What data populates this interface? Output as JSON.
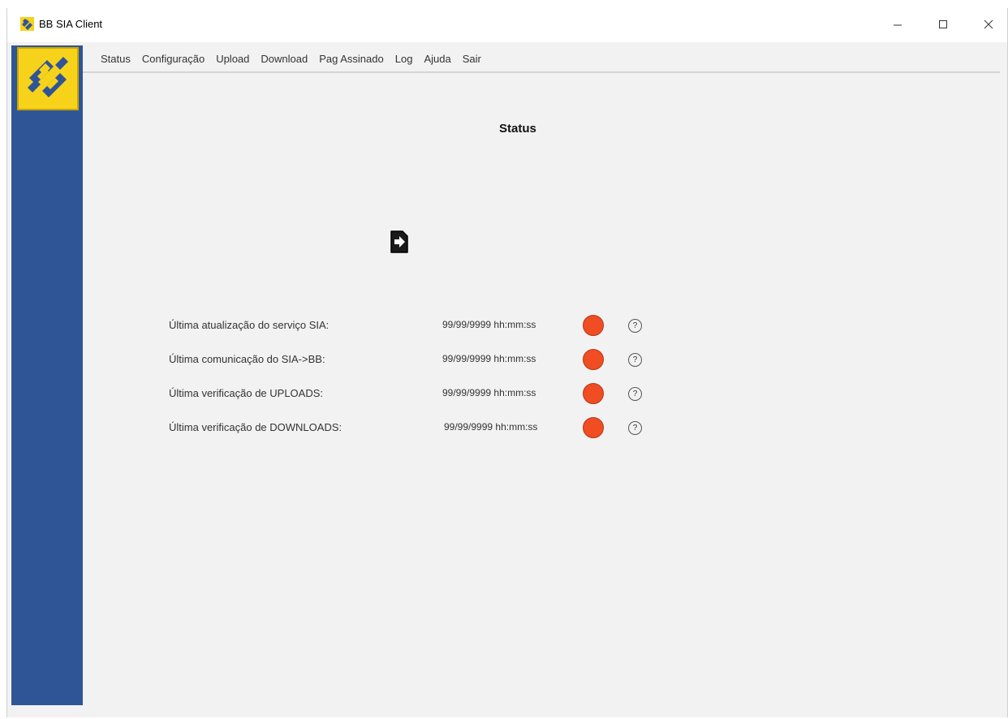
{
  "window": {
    "title": "BB SIA Client",
    "controls": [
      "minimize-icon",
      "maximize-icon",
      "close-icon"
    ]
  },
  "menu": {
    "items": [
      {
        "label": "Status"
      },
      {
        "label": "Configuração"
      },
      {
        "label": "Upload"
      },
      {
        "label": "Download"
      },
      {
        "label": "Pag Assinado"
      },
      {
        "label": "Log"
      },
      {
        "label": "Ajuda"
      },
      {
        "label": "Sair"
      }
    ]
  },
  "page": {
    "title": "Status",
    "action_icon": "exit-icon"
  },
  "status_rows": [
    {
      "label": "Última atualização do serviço SIA:",
      "value": "99/99/9999 hh:mm:ss",
      "status_color": "#f04d22",
      "help": "?"
    },
    {
      "label": "Última comunicação do SIA->BB:",
      "value": "99/99/9999 hh:mm:ss",
      "status_color": "#f04d22",
      "help": "?"
    },
    {
      "label": "Última verificação de UPLOADS:",
      "value": "99/99/9999 hh:mm:ss",
      "status_color": "#f04d22",
      "help": "?"
    },
    {
      "label": "Última verificação de DOWNLOADS:",
      "value": "99/99/9999 hh:mm:ss",
      "status_color": "#f04d22",
      "help": "?"
    }
  ],
  "colors": {
    "sidebar": "#2f5597",
    "logo_background": "#f7d21a",
    "status_red": "#f04d22"
  }
}
